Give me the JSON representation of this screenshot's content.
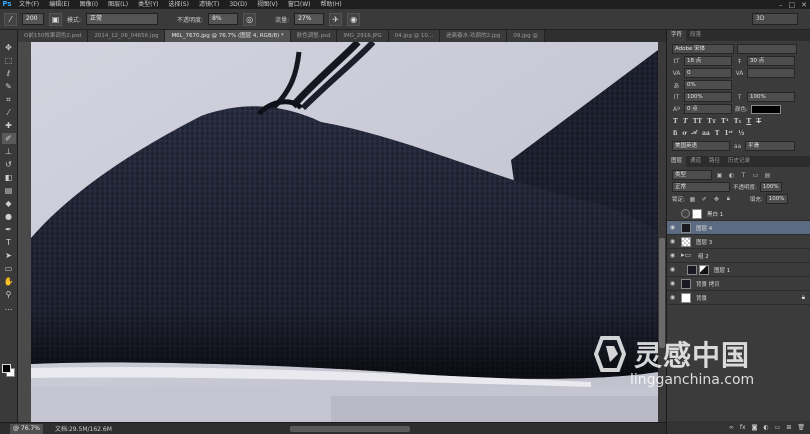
{
  "app": {
    "logo": "Ps"
  },
  "menu": [
    "文件(F)",
    "编辑(E)",
    "图像(I)",
    "图层(L)",
    "类型(Y)",
    "选择(S)",
    "滤镜(T)",
    "3D(D)",
    "视图(V)",
    "窗口(W)",
    "帮助(H)"
  ],
  "options": {
    "brush_size": "200",
    "mode_label": "模式:",
    "mode_value": "正常",
    "opacity_label": "不透明度:",
    "opacity_value": "8%",
    "flow_label": "流量:",
    "flow_value": "27%",
    "workspace": "3D"
  },
  "tabs": [
    "O前150效果调色2.psd",
    "2014_12_06_04656.jpg",
    "M6L_7670.jpg @ 76.7% (图层 4, RGB/8) *",
    "肤色调整.psd",
    "IMG_2916.JPG",
    "04.jpg @ 10...",
    "迷离春水-欢颜的2.jpg",
    "09.jpg @"
  ],
  "active_tab": 2,
  "status": {
    "zoom": "@ 76.7%",
    "doc": "文档:29.5M/162.6M"
  },
  "character_panel": {
    "tabs": [
      "字符",
      "段落"
    ],
    "font": "Adobe 宋体",
    "font_size": "18 点",
    "leading": "30 点",
    "kerning": "0",
    "tracking": "0%",
    "vscale": "100%",
    "hscale": "100%",
    "baseline": "0 点",
    "color_label": "颜色:",
    "language": "美国英语",
    "aa_label": "aa",
    "aa_value": "平滑"
  },
  "layers_panel": {
    "tabs": [
      "图层",
      "通道",
      "路径",
      "历史记录"
    ],
    "filter": "类型",
    "blend": "正常",
    "opacity_label": "不透明度:",
    "opacity": "100%",
    "lock_label": "锁定:",
    "fill_label": "填充:",
    "fill": "100%",
    "layers": [
      {
        "name": "黑白 1",
        "kind": "adjust",
        "visible": false,
        "selected": false
      },
      {
        "name": "图层 4",
        "kind": "dark",
        "visible": true,
        "selected": true
      },
      {
        "name": "图层 3",
        "kind": "check",
        "visible": true,
        "selected": false
      },
      {
        "name": "组 2",
        "kind": "folder",
        "visible": true,
        "selected": false
      },
      {
        "name": "图层 1",
        "kind": "mask",
        "visible": true,
        "selected": false
      },
      {
        "name": "背景 拷贝",
        "kind": "dark",
        "visible": true,
        "selected": false
      },
      {
        "name": "背景",
        "kind": "white",
        "visible": true,
        "selected": false
      }
    ]
  },
  "watermark": {
    "text": "灵感中国",
    "url": "lingganchina.com"
  }
}
